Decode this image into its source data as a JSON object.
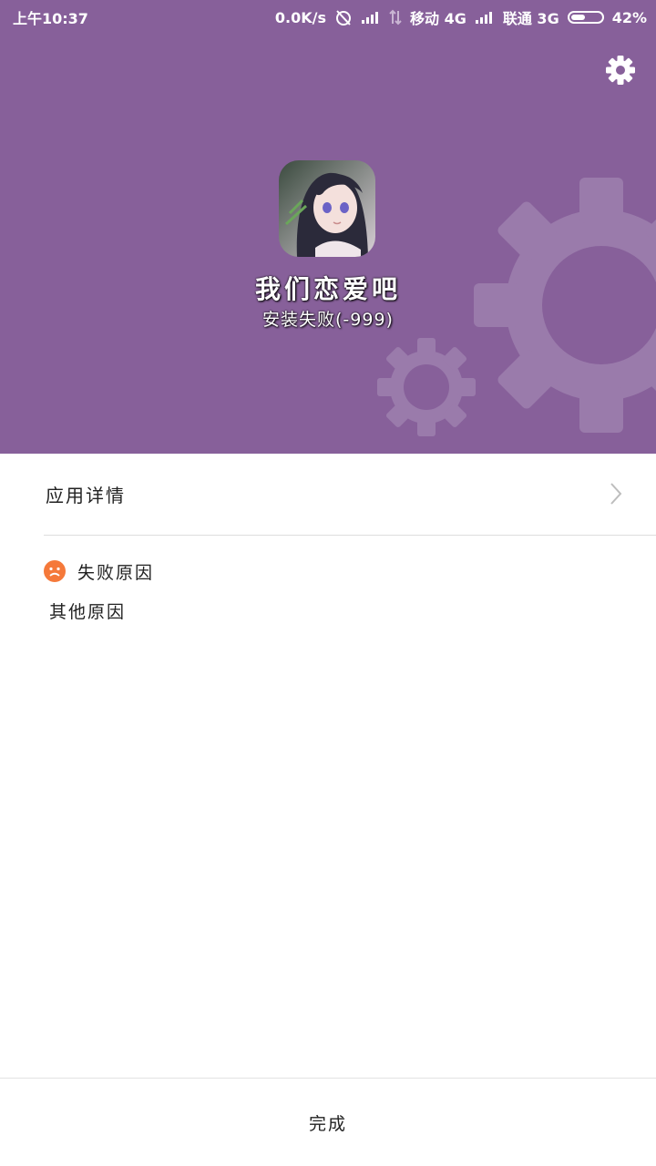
{
  "status_bar": {
    "time": "上午10:37",
    "net_speed": "0.0K/s",
    "carrier1": "移动 4G",
    "carrier2": "联通 3G",
    "battery": "42%"
  },
  "header": {
    "background_color": "#87609a",
    "settings_icon": "gear-icon",
    "app_name": "我们恋爱吧",
    "install_status": "安装失败(-999)"
  },
  "details": {
    "label": "应用详情",
    "icon": "chevron-right-icon"
  },
  "failure": {
    "icon": "sad-face-icon",
    "icon_color": "#f5793a",
    "title": "失败原因",
    "reason": "其他原因"
  },
  "footer": {
    "done_label": "完成"
  }
}
